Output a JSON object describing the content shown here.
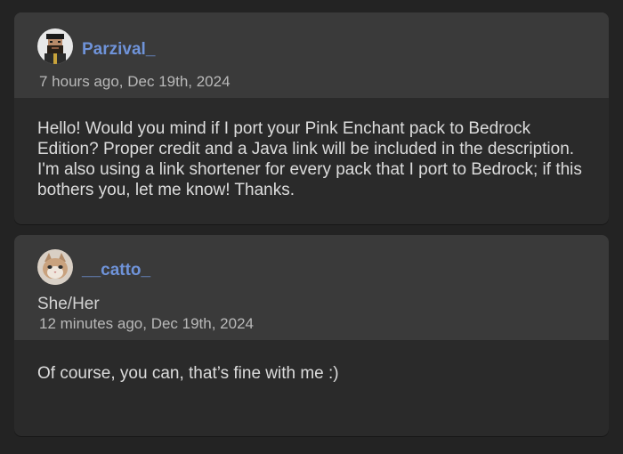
{
  "comments": [
    {
      "author": "Parzival_",
      "timestamp": "7 hours ago, Dec 19th, 2024",
      "body": "Hello! Would you mind if I port your Pink Enchant pack to Bedrock Edition? Proper credit and a Java link will be included in the description. I'm also using a link shortener for every pack that I port to Bedrock; if this bothers you, let me know! Thanks.",
      "avatar_icon": "pixel-bearded-man-avatar"
    },
    {
      "author": "__catto_",
      "pronouns": "She/Her",
      "timestamp": "12 minutes ago, Dec 19th, 2024",
      "body": "Of course, you can, that’s fine with me :)",
      "avatar_icon": "cat-avatar"
    }
  ],
  "colors": {
    "page_background": "#232323",
    "card_header": "#3a3a3a",
    "card_body": "#2a2a2a",
    "username": "#6f93d9"
  }
}
